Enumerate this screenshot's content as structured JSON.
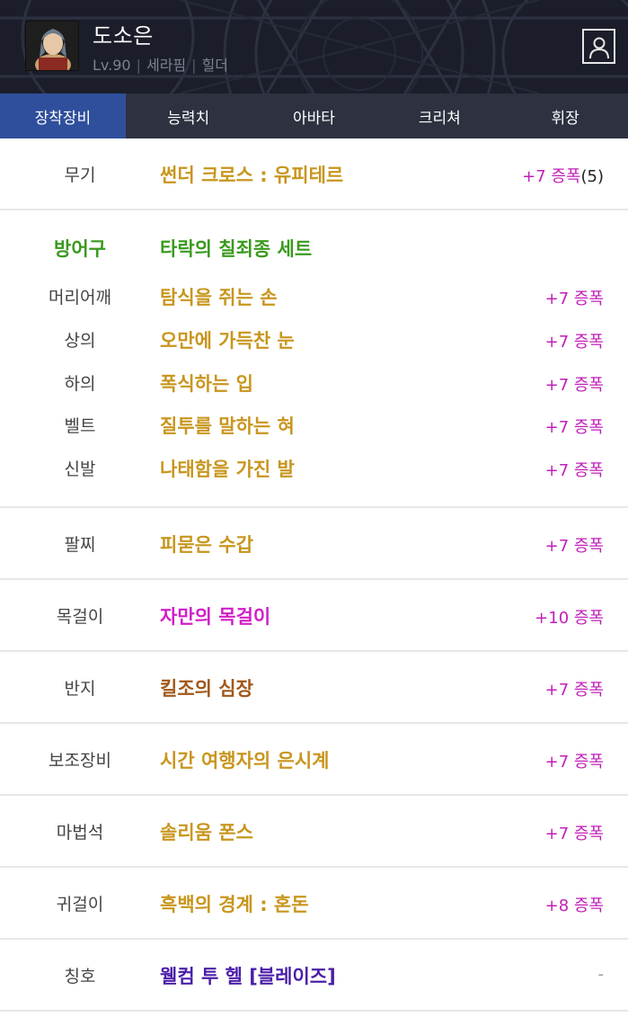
{
  "header": {
    "name": "도소은",
    "level": "Lv.90",
    "job": "세라핌",
    "server": "힐더",
    "separator": "|"
  },
  "tabs": [
    {
      "label": "장착장비",
      "active": true
    },
    {
      "label": "능력치",
      "active": false
    },
    {
      "label": "아바타",
      "active": false
    },
    {
      "label": "크리쳐",
      "active": false
    },
    {
      "label": "휘장",
      "active": false
    }
  ],
  "weapon": {
    "slot": "무기",
    "name": "썬더 크로스 : 유피테르",
    "enhance": "+7 증폭",
    "count": "(5)"
  },
  "armor": {
    "slot": "방어구",
    "set_name": "타락의 칠죄종 세트",
    "items": [
      {
        "slot": "머리어깨",
        "name": "탐식을 쥐는 손",
        "enhance": "+7 증폭"
      },
      {
        "slot": "상의",
        "name": "오만에 가득찬 눈",
        "enhance": "+7 증폭"
      },
      {
        "slot": "하의",
        "name": "폭식하는 입",
        "enhance": "+7 증폭"
      },
      {
        "slot": "벨트",
        "name": "질투를 말하는 혀",
        "enhance": "+7 증폭"
      },
      {
        "slot": "신발",
        "name": "나태함을 가진 발",
        "enhance": "+7 증폭"
      }
    ]
  },
  "accessories": [
    {
      "slot": "팔찌",
      "name": "피묻은 수갑",
      "enhance": "+7 증폭"
    },
    {
      "slot": "목걸이",
      "name": "자만의 목걸이",
      "enhance": "+10 증폭"
    },
    {
      "slot": "반지",
      "name": "킬조의 심장",
      "enhance": "+7 증폭"
    },
    {
      "slot": "보조장비",
      "name": "시간 여행자의 은시계",
      "enhance": "+7 증폭"
    },
    {
      "slot": "마법석",
      "name": "솔리움 폰스",
      "enhance": "+7 증폭"
    },
    {
      "slot": "귀걸이",
      "name": "흑백의 경계 : 혼돈",
      "enhance": "+8 증폭"
    }
  ],
  "title": {
    "slot": "칭호",
    "name": "웰컴 투 헬 [블레이즈]",
    "enhance": "-"
  },
  "colors": {
    "header_bg": "#1a1d29",
    "tab_bg": "#2d3140",
    "tab_active": "#2f4f9d",
    "item_gold": "#c8961e",
    "set_green": "#3a9a1e",
    "item_magenta": "#d01fc8",
    "item_brown": "#a0581a",
    "item_purple": "#4b1fa8",
    "enhance_magenta": "#c01fb8"
  },
  "icons": {
    "profile": "person-card-icon",
    "avatar": "character-portrait"
  }
}
